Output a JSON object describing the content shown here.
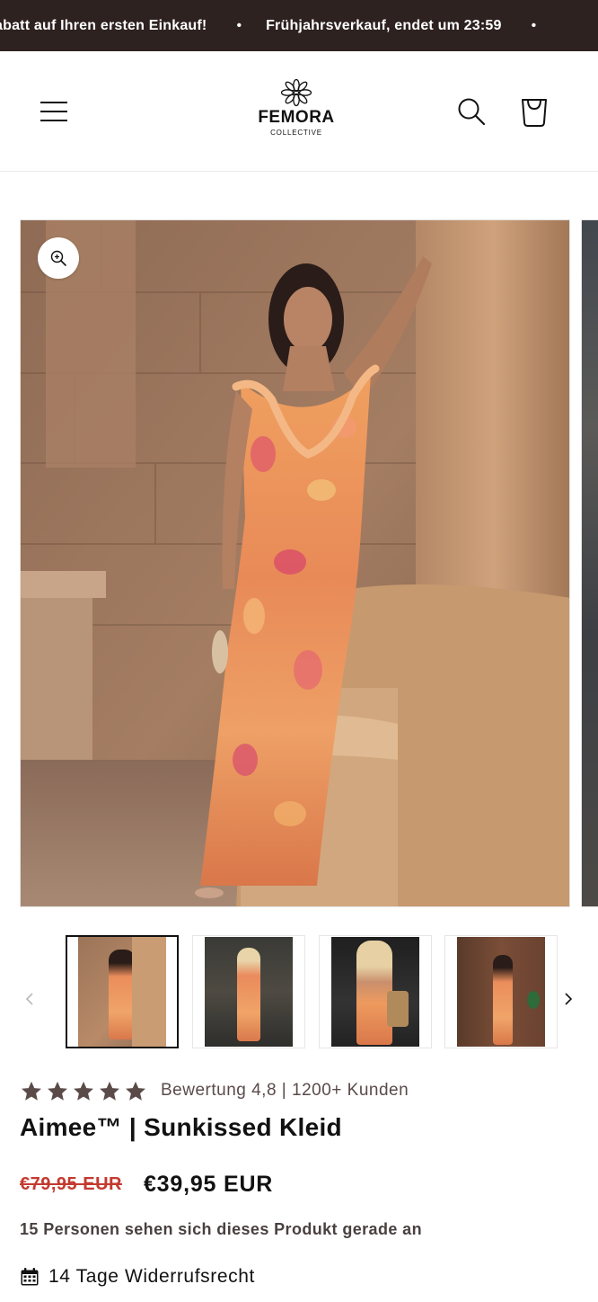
{
  "announcement": {
    "messages": [
      "abatt auf Ihren ersten Einkauf!",
      "Frühjahrsverkauf, endet um 23:59"
    ],
    "separator": "•"
  },
  "header": {
    "brand": "FEMORA",
    "brand_sub": "COLLECTIVE",
    "icons": [
      "menu-icon",
      "search-icon",
      "cart-icon"
    ]
  },
  "gallery": {
    "zoom_icon": "zoom-in-icon",
    "thumbnail_count": 4,
    "active_thumbnail": 1
  },
  "product": {
    "rating_stars": 5,
    "rating_text": "Bewertung 4,8 | 1200+ Kunden",
    "title": "Aimee™ | Sunkissed Kleid",
    "old_price": "€79,95 EUR",
    "new_price": "€39,95 EUR",
    "viewers_text": "15 Personen sehen sich dieses Produkt gerade an",
    "return_text": "14 Tage Widerrufsrecht",
    "return_icon": "calendar-icon"
  },
  "colors": {
    "announcement_bg": "#2e2221",
    "sale_red": "#c43a2f",
    "star": "#5a4b49"
  }
}
